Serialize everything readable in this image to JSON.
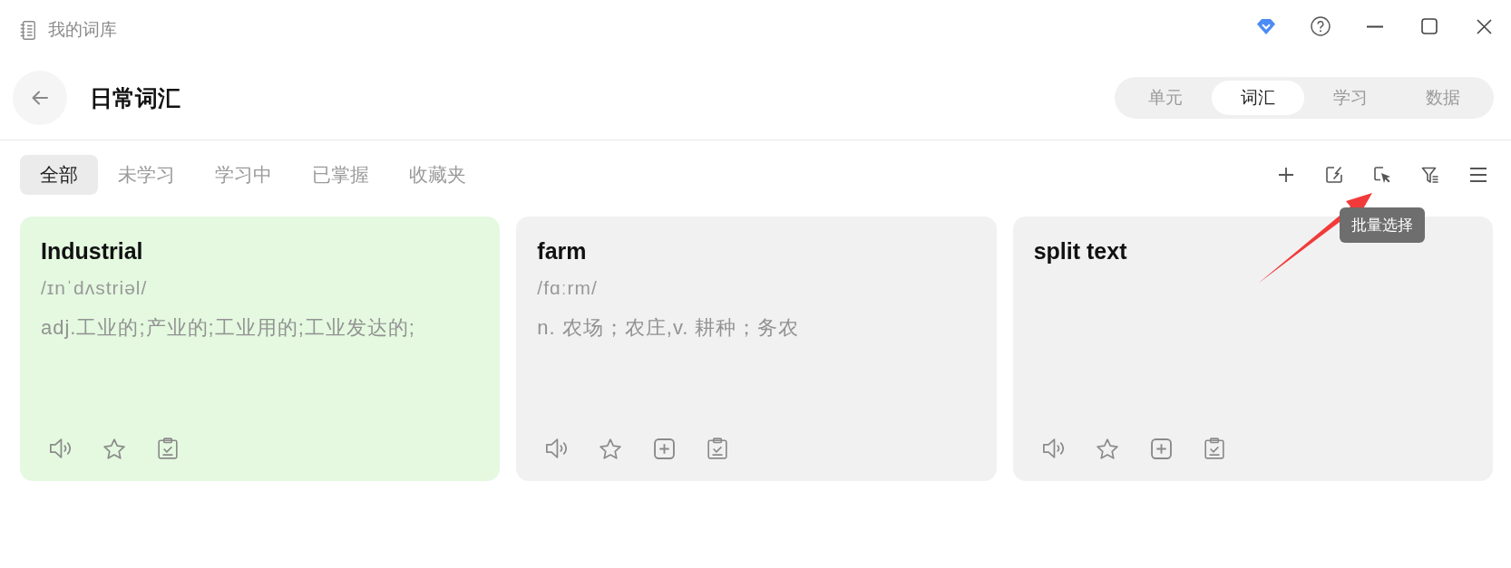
{
  "window": {
    "title": "我的词库"
  },
  "header": {
    "title": "日常词汇",
    "view_tabs": [
      {
        "label": "单元",
        "selected": false
      },
      {
        "label": "词汇",
        "selected": true
      },
      {
        "label": "学习",
        "selected": false
      },
      {
        "label": "数据",
        "selected": false
      }
    ]
  },
  "filter_tabs": [
    {
      "label": "全部",
      "selected": true
    },
    {
      "label": "未学习",
      "selected": false
    },
    {
      "label": "学习中",
      "selected": false
    },
    {
      "label": "已掌握",
      "selected": false
    },
    {
      "label": "收藏夹",
      "selected": false
    }
  ],
  "toolbar": {
    "tooltip": "批量选择"
  },
  "cards": [
    {
      "word": "Industrial",
      "phonetic": "/ɪnˈdʌstriəl/",
      "definition": "adj.工业的;产业的;工业用的;工业发达的;",
      "highlighted": true,
      "starred": false,
      "actions": [
        {
          "kind": "speak"
        },
        {
          "kind": "star"
        },
        {
          "kind": "review"
        }
      ]
    },
    {
      "word": "farm",
      "phonetic": "/fɑːrm/",
      "definition": "n. 农场；农庄,v. 耕种；务农",
      "highlighted": false,
      "starred": false,
      "actions": [
        {
          "kind": "speak"
        },
        {
          "kind": "star"
        },
        {
          "kind": "add"
        },
        {
          "kind": "review"
        }
      ]
    },
    {
      "word": "split text",
      "highlighted": false,
      "starred": false,
      "actions": [
        {
          "kind": "speak"
        },
        {
          "kind": "star"
        },
        {
          "kind": "add"
        },
        {
          "kind": "review"
        }
      ]
    }
  ]
}
